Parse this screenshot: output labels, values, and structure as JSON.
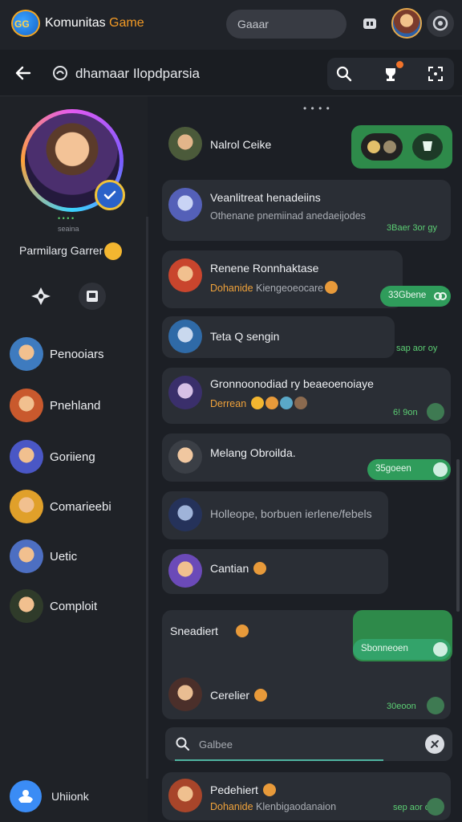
{
  "app": {
    "logo_text": "GG",
    "title_main": "Komunitas ",
    "title_accent": "Game",
    "search_placeholder": "Gaaar"
  },
  "channel": {
    "title": "dhamaar Ilopdparsia",
    "top_dots": "• • • •"
  },
  "profile": {
    "status_online": "• • • •",
    "subtitle": "seaina",
    "name": "Parmilarg Garrer"
  },
  "contacts": [
    {
      "name": "Penooiars",
      "color": "#3e7bbf"
    },
    {
      "name": "Pnehland",
      "color": "#c9592d"
    },
    {
      "name": "Goriieng",
      "color": "#4a57c5"
    },
    {
      "name": "Comarieebi",
      "color": "#e0a02a"
    },
    {
      "name": "Uetic",
      "color": "#4d6fc2"
    },
    {
      "name": "Comploit",
      "color": "#2f3b2a"
    }
  ],
  "user_footer": {
    "label": "Uhiionk"
  },
  "messages": [
    {
      "title": "Nalrol Ceike"
    },
    {
      "title": "Veanlitreat henadeiins",
      "subtitle": "Othenane pnemiinad anedaeijodes",
      "meta": "3Baer 3or gy"
    },
    {
      "title": "Renene Ronnhaktase",
      "subtitle": "Dohanide",
      "subtitle_rest": " Kiengeoeocare",
      "pill": "33Gbene"
    },
    {
      "title": "Teta Q sengin",
      "meta": "sap aor oy"
    },
    {
      "title": "Gronnoonodiad ry beaeoenoiaye",
      "subtitle": "Derrean",
      "meta": "6! 9on"
    },
    {
      "title": "Melang Obroilda.",
      "pill": "35goeen"
    },
    {
      "title": "Holleope, borbuen ierlene/febels"
    },
    {
      "title": "Cantian"
    },
    {
      "title": "Sneadiert",
      "pill": "Sbonneoen",
      "sub_title": "Cerelier",
      "meta": "30eoon"
    },
    {
      "title": "Pedehiert",
      "subtitle": "Dohanide",
      "subtitle_rest": " Klenbigaodanaion",
      "meta": "sep aor oy"
    }
  ],
  "composer": {
    "placeholder": "Galbee"
  }
}
